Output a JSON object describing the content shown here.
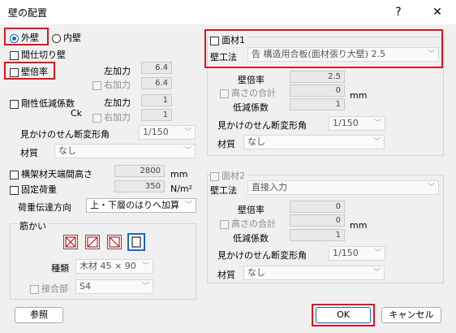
{
  "window": {
    "title": "壁の配置",
    "help_label": "?",
    "close_label": "✕"
  },
  "left": {
    "outer_wall_label": "外壁",
    "inner_wall_label": "内壁",
    "partition_label": "間仕切り壁",
    "ratio_label": "壁倍率",
    "left_force_label": "左加力",
    "left_force_value": "6.4",
    "right_force_label": "右加力",
    "right_force_value": "6.4",
    "rigidity_label": "剛性低減係数",
    "ck_label": "Ck",
    "ck_left_label": "左加力",
    "ck_left_value": "1",
    "ck_right_label": "右加力",
    "ck_right_value": "1",
    "shear_angle_label": "見かけのせん断変形角",
    "shear_angle_value": "1/150",
    "material_label": "材質",
    "material_value": "なし",
    "beam_height_label": "横架材天端間高さ",
    "beam_height_value": "2800",
    "beam_height_unit": "mm",
    "fixed_load_label": "固定荷重",
    "fixed_load_value": "350",
    "fixed_load_unit": "N/m²",
    "load_transfer_label": "荷重伝達方向",
    "load_transfer_value": "上・下層のはりへ加算",
    "brace_group_label": "筋かい",
    "brace_kind_label": "種類",
    "brace_kind_value": "木材 45 × 90",
    "joint_label": "接合部",
    "joint_value": "S4"
  },
  "panel1": {
    "title": "面材1",
    "method_label": "壁工法",
    "method_value": "告 構造用合板(面材張り大壁) 2.5",
    "ratio_label": "壁倍率",
    "ratio_value": "2.5",
    "height_sum_label": "高さの合計",
    "height_sum_value": "0",
    "unit": "mm",
    "reduction_label": "低減係数",
    "reduction_value": "1",
    "shear_angle_label": "見かけのせん断変形角",
    "shear_angle_value": "1/150",
    "material_label": "材質",
    "material_value": "なし"
  },
  "panel2": {
    "title": "面材2",
    "method_label": "壁工法",
    "method_value": "直接入力",
    "ratio_label": "壁倍率",
    "ratio_value": "0",
    "height_sum_label": "高さの合計",
    "height_sum_value": "0",
    "unit": "mm",
    "reduction_label": "低減係数",
    "reduction_value": "1",
    "shear_angle_label": "見かけのせん断変形角",
    "shear_angle_value": "1/150",
    "material_label": "材質",
    "material_value": "なし"
  },
  "footer": {
    "reference_label": "参照",
    "ok_label": "OK",
    "cancel_label": "キャンセル"
  },
  "colors": {
    "highlight": "#e0141b",
    "accent": "#1e63c6"
  }
}
